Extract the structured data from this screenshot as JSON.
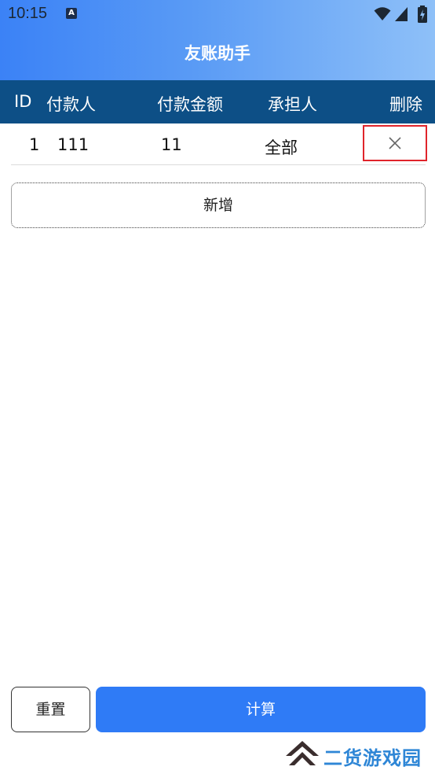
{
  "status_bar": {
    "time": "10:15",
    "notification_icon": "A",
    "icons": [
      "wifi-icon",
      "signal-icon",
      "battery-icon"
    ]
  },
  "app": {
    "title": "友账助手"
  },
  "table": {
    "headers": {
      "id": "ID",
      "payer": "付款人",
      "amount": "付款金额",
      "bearer": "承担人",
      "delete": "删除"
    },
    "rows": [
      {
        "id": "1",
        "payer": "111",
        "amount": "11",
        "bearer": "全部",
        "delete_icon": "close-icon"
      }
    ]
  },
  "actions": {
    "add_label": "新增",
    "reset_label": "重置",
    "calculate_label": "计算"
  },
  "watermark": {
    "text": "二货游戏园"
  },
  "colors": {
    "header_gradient_start": "#3b82f6",
    "header_gradient_end": "#8ec0f8",
    "table_header_bg": "#0d4f86",
    "primary_button": "#2f7bf6",
    "delete_highlight": "#e0242b",
    "watermark_text": "#2e86d6"
  }
}
